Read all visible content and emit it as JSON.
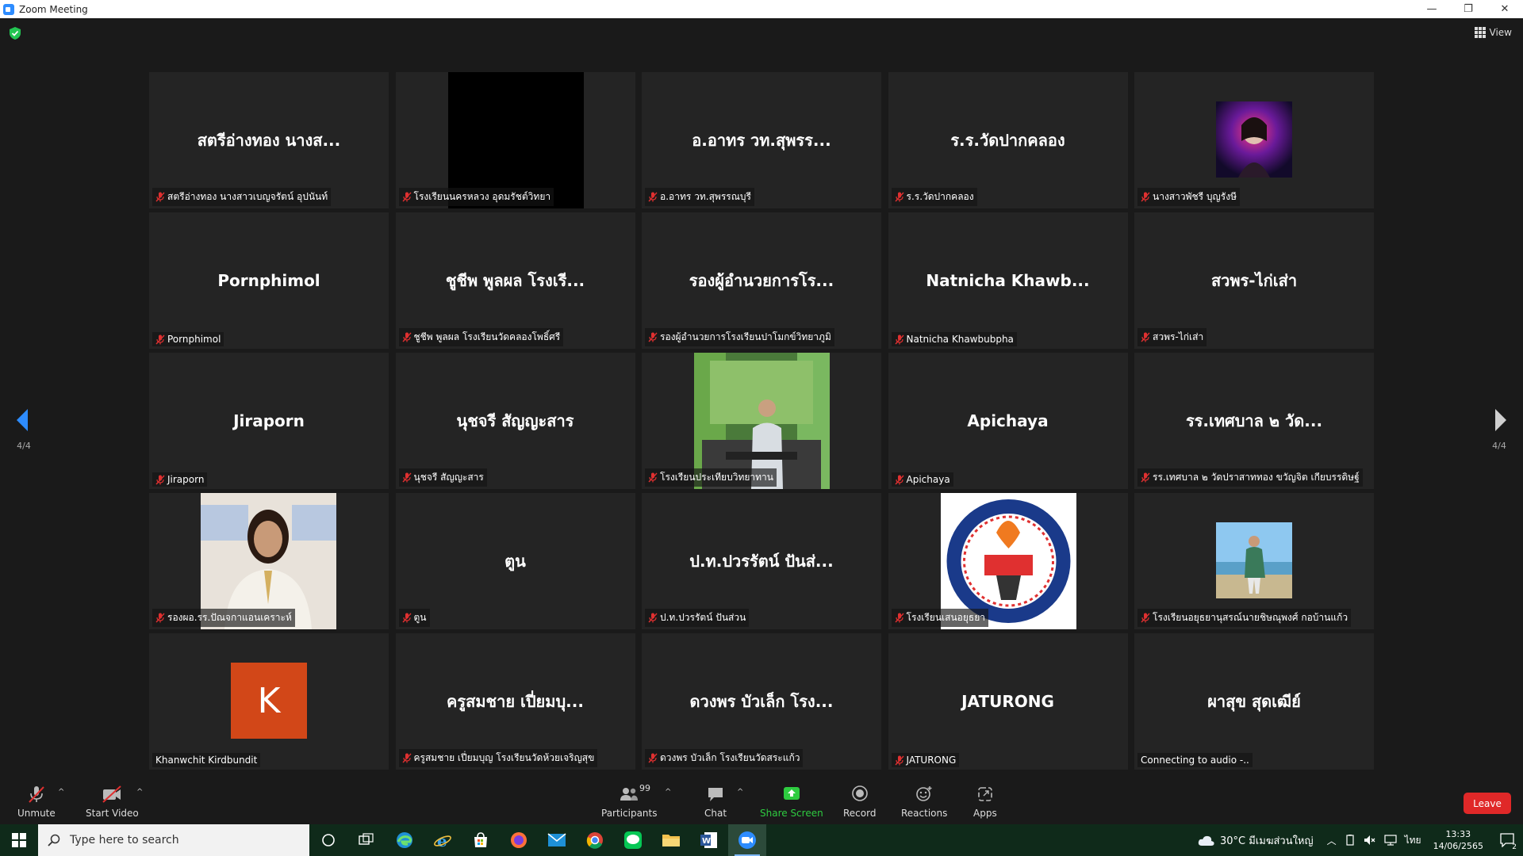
{
  "window": {
    "title": "Zoom Meeting",
    "minimize": "—",
    "restore": "❐",
    "close": "✕"
  },
  "topbar": {
    "view_label": "View"
  },
  "pagination": {
    "left_label": "4/4",
    "right_label": "4/4"
  },
  "tiles": [
    {
      "display": "สตรีอ่างทอง นางส...",
      "tag": "สตรีอ่างทอง นางสาวเบญจรัตน์ อุปนันท์",
      "muted": true
    },
    {
      "display": "",
      "tag": "โรงเรียนนครหลวง อุดมรัชต์วิทยา",
      "muted": true
    },
    {
      "display": "อ.อาทร  วท.สุพรร...",
      "tag": "อ.อาทร  วท.สุพรรณบุรี",
      "muted": true
    },
    {
      "display": "ร.ร.วัดปากคลอง",
      "tag": "ร.ร.วัดปากคลอง",
      "muted": true
    },
    {
      "display": "",
      "tag": "นางสาวพัชรี บุญรังษี",
      "muted": true
    },
    {
      "display": "Pornphimol",
      "tag": "Pornphimol",
      "muted": true
    },
    {
      "display": "ชูชีพ พูลผล โรงเรี...",
      "tag": "ชูชีพ พูลผล โรงเรียนวัดคลองโพธิ์ศรี",
      "muted": true
    },
    {
      "display": "รองผู้อำนวยการโร...",
      "tag": "รองผู้อำนวยการโรงเรียนปาโมกข์วิทยาภูมิ",
      "muted": true
    },
    {
      "display": "Natnicha  Khawb...",
      "tag": "Natnicha Khawbubpha",
      "muted": true
    },
    {
      "display": "สวพร-ไก่เส่า",
      "tag": "สวพร-ไก่เส่า",
      "muted": true
    },
    {
      "display": "Jiraporn",
      "tag": "Jiraporn",
      "muted": true
    },
    {
      "display": "นุชจรี สัญญะสาร",
      "tag": "นุชจรี สัญญะสาร",
      "muted": true
    },
    {
      "display": "",
      "tag": "โรงเรียนประเทียบวิทยาทาน",
      "muted": true
    },
    {
      "display": "Apichaya",
      "tag": "Apichaya",
      "muted": true
    },
    {
      "display": "รร.เทศบาล ๒ วัด...",
      "tag": "รร.เทศบาล ๒ วัดปราสาททอง ขวัญจิต เกียบรรดิษฐ์",
      "muted": true
    },
    {
      "display": "",
      "tag": "รองผอ.รร.ปัณจกาแอนเคราะห์",
      "muted": true
    },
    {
      "display": "ตูน",
      "tag": "ตูน",
      "muted": true
    },
    {
      "display": "ป.ท.ปวรรัตน์ ปันส่...",
      "tag": "ป.ท.ปวรรัตน์ ปันส่วน",
      "muted": true
    },
    {
      "display": "",
      "tag": "โรงเรียนเสนอยุธยา",
      "muted": true
    },
    {
      "display": "",
      "tag": "โรงเรียนอยุธยานุสรณ์นายชิษณุพงศ์ กอบ้านแก้ว",
      "muted": true
    },
    {
      "display": "",
      "tag": "Khanwchit Kirdbundit",
      "muted": false,
      "avatar_letter": "K"
    },
    {
      "display": "ครูสมชาย  เปี่ยมบุ...",
      "tag": "ครูสมชาย  เปี่ยมบุญ โรงเรียนวัดห้วยเจริญสุข",
      "muted": true
    },
    {
      "display": "ดวงพร บัวเล็ก โรง...",
      "tag": "ดวงพร บัวเล็ก โรงเรียนวัดสระแก้ว",
      "muted": true
    },
    {
      "display": "JATURONG",
      "tag": "JATURONG",
      "muted": true
    },
    {
      "display": "ผาสุข สุดเฒีย์",
      "tag": "Connecting to audio -..",
      "muted": false
    }
  ],
  "toolbar": {
    "unmute": "Unmute",
    "start_video": "Start Video",
    "participants": "Participants",
    "participants_count": "99",
    "chat": "Chat",
    "share_screen": "Share Screen",
    "record": "Record",
    "reactions": "Reactions",
    "apps": "Apps",
    "leave": "Leave",
    "caret": "^"
  },
  "taskbar": {
    "search_placeholder": "Type here to search",
    "weather": "30°C  มีเมฆส่วนใหญ่",
    "lang": "ไทย",
    "time": "13:33",
    "date": "14/06/2565",
    "notifications": "2"
  },
  "colors": {
    "accent_blue": "#2d8cff",
    "share_green": "#2ecc40",
    "leave_red": "#e02828",
    "muted_red": "#e03030",
    "avatar_orange": "#d24718"
  }
}
